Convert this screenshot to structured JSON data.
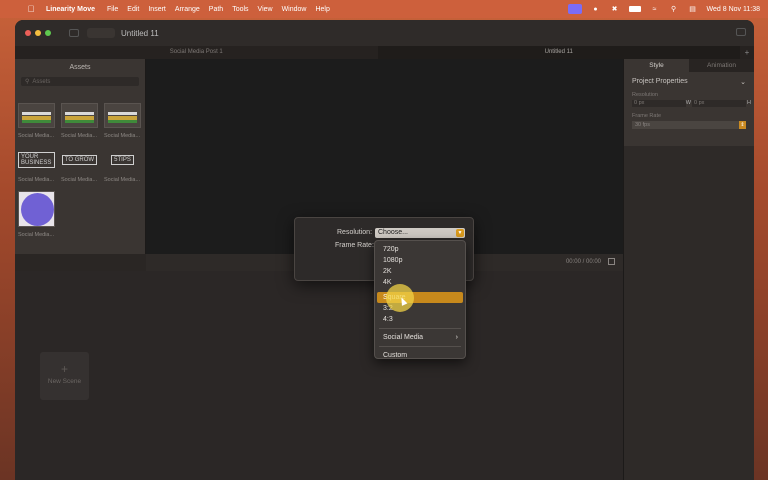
{
  "menubar": {
    "app_name": "Linearity Move",
    "menus": [
      "File",
      "Edit",
      "Insert",
      "Arrange",
      "Path",
      "Tools",
      "View",
      "Window",
      "Help"
    ],
    "clock": "Wed 8 Nov  11:38"
  },
  "window": {
    "title": "Untitled 11",
    "doc_tabs": [
      "Social Media Post 1",
      "Untitled 11"
    ]
  },
  "assets": {
    "title": "Assets",
    "search_placeholder": "Assets",
    "items": [
      {
        "label": "Social Media..."
      },
      {
        "label": "Social Media..."
      },
      {
        "label": "Social Media..."
      },
      {
        "label": "Social Media...",
        "thumb_text": "YOUR BUSINESS"
      },
      {
        "label": "Social Media...",
        "thumb_text": "TO GROW"
      },
      {
        "label": "Social Media...",
        "thumb_text": "5TIPS"
      },
      {
        "label": "Social Media..."
      }
    ]
  },
  "timeline": {
    "time": "00:00 / 00:00"
  },
  "scenes": {
    "new_scene_label": "New Scene"
  },
  "inspector": {
    "tabs": [
      "Style",
      "Animation"
    ],
    "section_title": "Project Properties",
    "resolution_label": "Resolution",
    "width_value": "0 px",
    "width_suffix": "W",
    "height_value": "0 px",
    "height_suffix": "H",
    "frame_rate_label": "Frame Rate",
    "frame_rate_value": "30 fps"
  },
  "dialog": {
    "resolution_label": "Resolution:",
    "resolution_value": "Choose...",
    "frame_rate_label": "Frame Rate:"
  },
  "dropdown": {
    "group1": [
      "720p",
      "1080p",
      "2K",
      "4K"
    ],
    "group2": [
      "Square",
      "3:2",
      "4:3"
    ],
    "selected": "Square",
    "submenu": "Social Media",
    "custom": "Custom"
  }
}
